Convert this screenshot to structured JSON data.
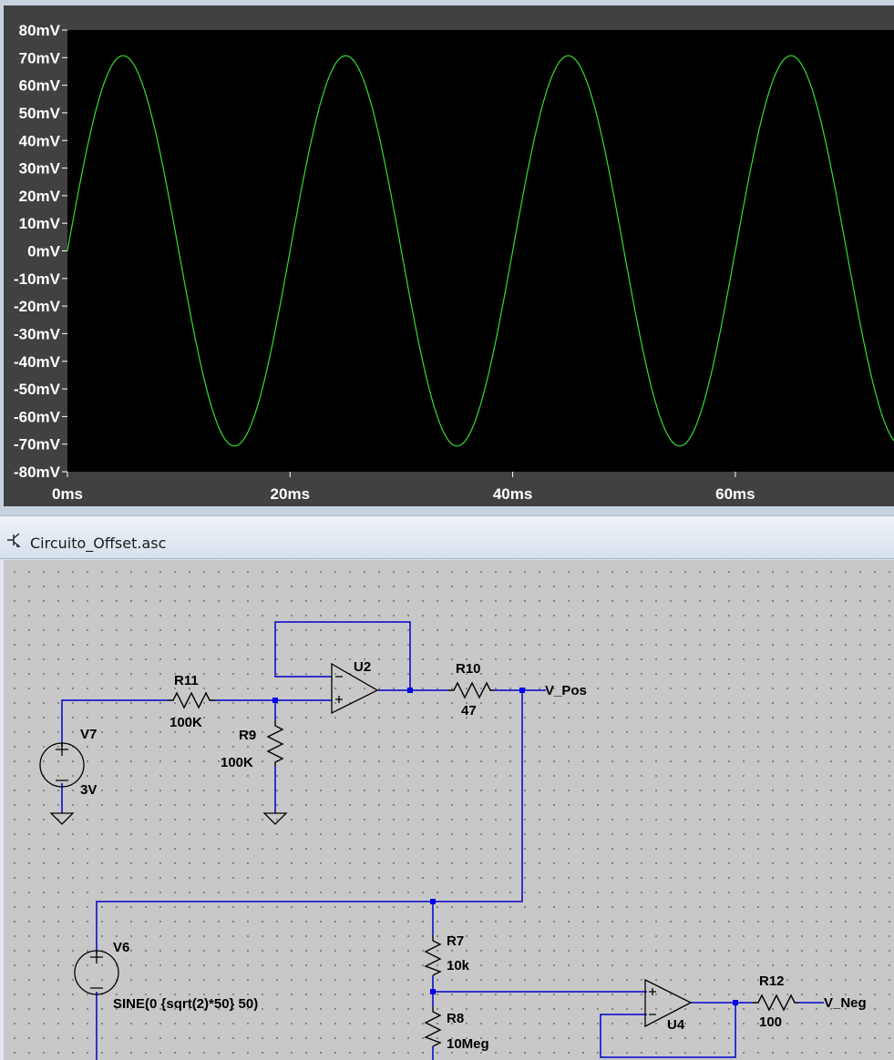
{
  "plot": {
    "line_color": "#33dd33",
    "background": "#000000",
    "y_ticks": [
      "80mV",
      "70mV",
      "60mV",
      "50mV",
      "40mV",
      "30mV",
      "20mV",
      "10mV",
      "0mV",
      "-10mV",
      "-20mV",
      "-30mV",
      "-40mV",
      "-50mV",
      "-60mV",
      "-70mV",
      "-80mV"
    ],
    "x_ticks": [
      "0ms",
      "20ms",
      "40ms",
      "60ms"
    ]
  },
  "chart_data": {
    "type": "line",
    "title": "",
    "xlabel": "",
    "ylabel": "",
    "x_unit": "ms",
    "y_unit": "mV",
    "xlim": [
      0,
      74.5
    ],
    "ylim": [
      -80,
      80
    ],
    "grid": false,
    "series": [
      {
        "amplitude_mV": 70.7,
        "frequency_Hz": 50,
        "offset_mV": 0,
        "shape": "sine"
      }
    ]
  },
  "schematic": {
    "file_name": "Circuito_Offset.asc",
    "wire_color": "#0000cc",
    "components": {
      "R11": {
        "name": "R11",
        "value": "100K"
      },
      "R9": {
        "name": "R9",
        "value": "100K"
      },
      "R10": {
        "name": "R10",
        "value": "47"
      },
      "R7": {
        "name": "R7",
        "value": "10k"
      },
      "R8": {
        "name": "R8",
        "value": "10Meg"
      },
      "R12": {
        "name": "R12",
        "value": "100"
      },
      "V7": {
        "name": "V7",
        "value": "3V"
      },
      "V6": {
        "name": "V6",
        "value": "SINE(0 {sqrt(2)*50} 50)"
      },
      "U2": {
        "name": "U2"
      },
      "U4": {
        "name": "U4"
      }
    },
    "nets": {
      "pos": "V_Pos",
      "neg": "V_Neg"
    }
  }
}
